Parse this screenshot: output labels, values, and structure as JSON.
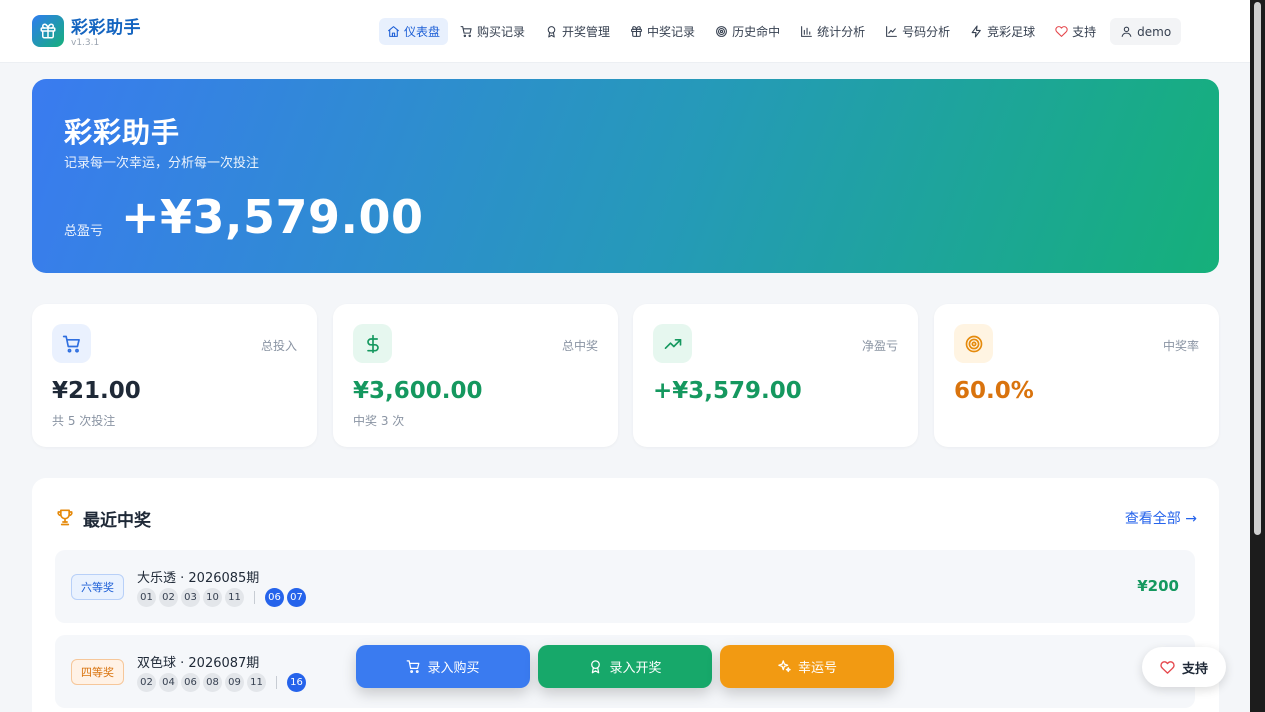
{
  "brand": {
    "name": "彩彩助手",
    "version": "v1.3.1"
  },
  "nav": [
    {
      "id": "dashboard",
      "label": "仪表盘",
      "icon": "home-icon",
      "active": true
    },
    {
      "id": "purchases",
      "label": "购买记录",
      "icon": "cart-icon"
    },
    {
      "id": "draws",
      "label": "开奖管理",
      "icon": "award-icon"
    },
    {
      "id": "wins",
      "label": "中奖记录",
      "icon": "gift-icon"
    },
    {
      "id": "history",
      "label": "历史命中",
      "icon": "target-icon"
    },
    {
      "id": "stats",
      "label": "统计分析",
      "icon": "bar-chart-icon"
    },
    {
      "id": "numbers",
      "label": "号码分析",
      "icon": "line-chart-icon"
    },
    {
      "id": "football",
      "label": "竞彩足球",
      "icon": "zap-icon"
    },
    {
      "id": "support",
      "label": "支持",
      "icon": "heart-icon"
    }
  ],
  "user": {
    "name": "demo"
  },
  "hero": {
    "title": "彩彩助手",
    "subtitle": "记录每一次幸运，分析每一次投注",
    "total_label": "总盈亏",
    "total_value": "+¥3,579.00"
  },
  "stats": [
    {
      "label": "总投入",
      "value": "¥21.00",
      "sub": "共 5 次投注",
      "icon": "cart-icon",
      "color": "#1f2937",
      "icon_bg": "#eaf1fe",
      "icon_color": "#2f6fe0"
    },
    {
      "label": "总中奖",
      "value": "¥3,600.00",
      "sub": "中奖 3 次",
      "icon": "dollar-icon",
      "color": "#15985f",
      "icon_bg": "#e6f7ef",
      "icon_color": "#15985f"
    },
    {
      "label": "净盈亏",
      "value": "+¥3,579.00",
      "sub": "",
      "icon": "trending-up-icon",
      "color": "#15985f",
      "icon_bg": "#e6f7ef",
      "icon_color": "#15985f"
    },
    {
      "label": "中奖率",
      "value": "60.0%",
      "sub": "",
      "icon": "target-icon",
      "color": "#d9730d",
      "icon_bg": "#fff4e2",
      "icon_color": "#e58a0c"
    }
  ],
  "recent": {
    "title": "最近中奖",
    "view_all": "查看全部 →",
    "items": [
      {
        "prize": "六等奖",
        "badge": "blue",
        "title": "大乐透 · 2026085期",
        "front": [
          "01",
          "02",
          "03",
          "10",
          "11"
        ],
        "back": [
          "06",
          "07"
        ],
        "amount": "¥200"
      },
      {
        "prize": "四等奖",
        "badge": "orange",
        "title": "双色球 · 2026087期",
        "front": [
          "02",
          "04",
          "06",
          "08",
          "09",
          "11"
        ],
        "back": [
          "16"
        ],
        "amount": ""
      }
    ]
  },
  "actions": [
    {
      "label": "录入购买",
      "icon": "cart-icon",
      "color": "#3a7bf0"
    },
    {
      "label": "录入开奖",
      "icon": "award-icon",
      "color": "#17a86a"
    },
    {
      "label": "幸运号",
      "icon": "sparkles-icon",
      "color": "#f29a12"
    }
  ],
  "support_float": {
    "label": "支持",
    "icon": "heart-icon"
  },
  "colors": {
    "accent": "#2563eb",
    "positive": "#15985f",
    "warning": "#d9730d"
  }
}
